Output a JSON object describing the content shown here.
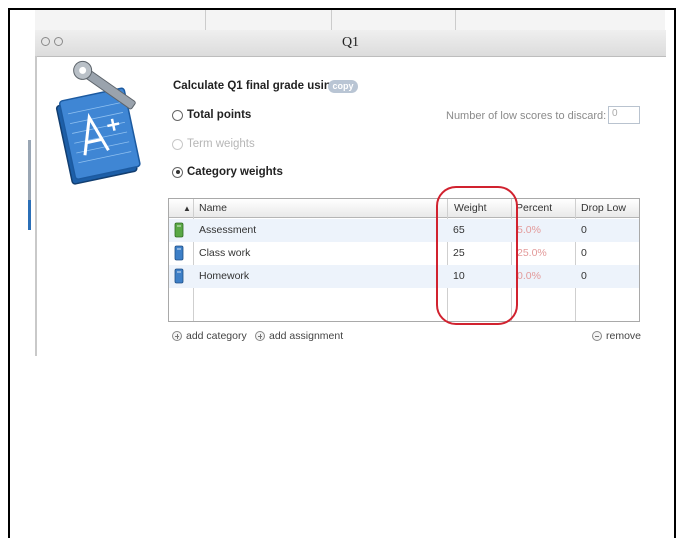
{
  "window": {
    "title": "Q1"
  },
  "calc": {
    "label": "Calculate Q1 final grade using:",
    "copy_label": "copy"
  },
  "options": [
    {
      "label": "Total points",
      "selected": false,
      "enabled": true
    },
    {
      "label": "Term weights",
      "selected": false,
      "enabled": false
    },
    {
      "label": "Category weights",
      "selected": true,
      "enabled": true
    }
  ],
  "discard": {
    "label": "Number of low scores to discard:",
    "value": "0"
  },
  "table": {
    "sort_indicator": "▲",
    "columns": [
      "Name",
      "Weight",
      "Percent",
      "Drop Low"
    ],
    "rows": [
      {
        "name": "Assessment",
        "weight": "65",
        "percent": "5.0%",
        "drop_low": "0",
        "icon_color": "#5aa845"
      },
      {
        "name": "Class work",
        "weight": "25",
        "percent": "25.0%",
        "drop_low": "0",
        "icon_color": "#3d7fc7"
      },
      {
        "name": "Homework",
        "weight": "10",
        "percent": "0.0%",
        "drop_low": "0",
        "icon_color": "#3d7fc7"
      }
    ]
  },
  "footer": {
    "add_category": "add category",
    "add_assignment": "add assignment",
    "remove": "remove"
  },
  "colors": {
    "highlight_circle": "#d1222f",
    "row_alt": "#edf3fb"
  }
}
